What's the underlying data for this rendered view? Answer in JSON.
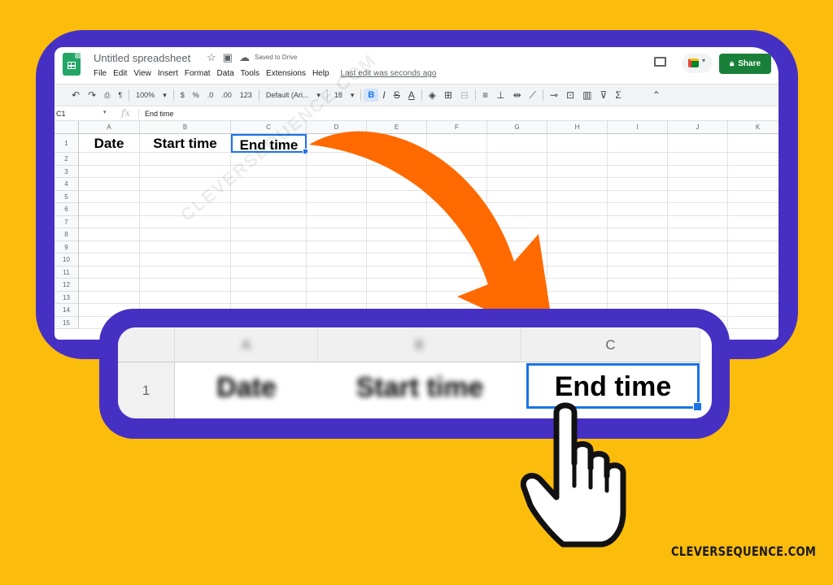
{
  "app": {
    "doc_title": "Untitled spreadsheet",
    "saved_status": "Saved to Drive",
    "menu": [
      "File",
      "Edit",
      "View",
      "Insert",
      "Format",
      "Data",
      "Tools",
      "Extensions",
      "Help"
    ],
    "last_edit": "Last edit was seconds ago",
    "share_label": "Share"
  },
  "toolbar": {
    "zoom": "100%",
    "currency": "$",
    "percent": "%",
    "decimal_less": ".0",
    "decimal_more": ".00",
    "number_format": "123",
    "font": "Default (Ari...",
    "font_size": "18",
    "bold": "B",
    "italic": "I",
    "strike": "S",
    "text_color": "A"
  },
  "formula_bar": {
    "cell_ref": "C1",
    "fx": "fx",
    "value": "End time"
  },
  "grid": {
    "columns": [
      "A",
      "B",
      "C",
      "D",
      "E",
      "F",
      "G",
      "H",
      "I",
      "J",
      "K"
    ],
    "rows": [
      "1",
      "2",
      "3",
      "4",
      "5",
      "6",
      "7",
      "8",
      "9",
      "10",
      "11",
      "12",
      "13",
      "14",
      "15"
    ],
    "cells": {
      "A1": "Date",
      "B1": "Start time",
      "C1": "End time"
    },
    "selected_cell": "C1"
  },
  "zoom_callout": {
    "columns": [
      "A",
      "B",
      "C"
    ],
    "row": "1",
    "cells": [
      "Date",
      "Start time",
      "End time"
    ]
  },
  "watermark": "CLEVERSEQUENCE.COM",
  "brand": "CLEVERSEQUENCE.COM",
  "colors": {
    "background": "#fcbc0c",
    "frame": "#4630c4",
    "arrow": "#ff6a00",
    "share_button": "#188038",
    "selection": "#1a73e8"
  }
}
